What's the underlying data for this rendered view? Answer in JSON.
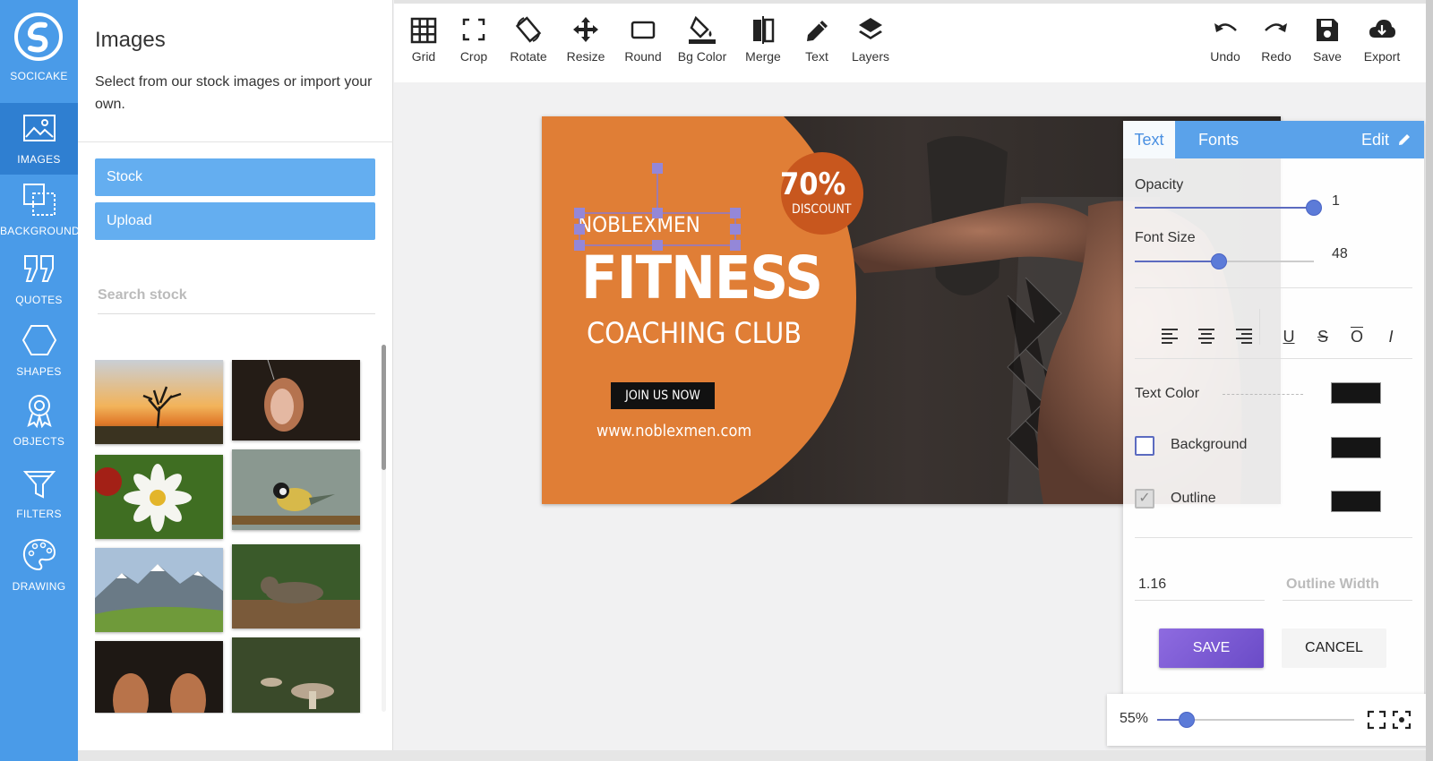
{
  "app": {
    "name": "SOCICAKE"
  },
  "nav": {
    "items": [
      {
        "label": "IMAGES",
        "icon": "image-icon"
      },
      {
        "label": "BACKGROUND",
        "icon": "background-icon"
      },
      {
        "label": "QUOTES",
        "icon": "quote-icon"
      },
      {
        "label": "SHAPES",
        "icon": "hexagon-icon"
      },
      {
        "label": "OBJECTS",
        "icon": "badge-icon"
      },
      {
        "label": "FILTERS",
        "icon": "funnel-icon"
      },
      {
        "label": "DRAWING",
        "icon": "palette-icon"
      }
    ]
  },
  "panel": {
    "title": "Images",
    "description": "Select from our stock images or import your own.",
    "stock_label": "Stock",
    "upload_label": "Upload",
    "search_placeholder": "Search stock"
  },
  "toolbar": {
    "tools": [
      {
        "label": "Grid",
        "icon": "grid-icon"
      },
      {
        "label": "Crop",
        "icon": "crop-icon"
      },
      {
        "label": "Rotate",
        "icon": "rotate-icon"
      },
      {
        "label": "Resize",
        "icon": "move-icon"
      },
      {
        "label": "Round",
        "icon": "rounded-rect-icon"
      },
      {
        "label": "Bg Color",
        "icon": "paint-bucket-icon"
      },
      {
        "label": "Merge",
        "icon": "merge-icon"
      },
      {
        "label": "Text",
        "icon": "pencil-icon"
      },
      {
        "label": "Layers",
        "icon": "layers-icon"
      }
    ],
    "actions": [
      {
        "label": "Undo",
        "icon": "undo-icon"
      },
      {
        "label": "Redo",
        "icon": "redo-icon"
      },
      {
        "label": "Save",
        "icon": "floppy-icon"
      },
      {
        "label": "Export",
        "icon": "cloud-download-icon"
      }
    ]
  },
  "design": {
    "brand": "NOBLEXMEN",
    "headline": "FITNESS",
    "subheadline": "COACHING CLUB",
    "badge_percent": "70%",
    "badge_text": "DISCOUNT",
    "cta": "JOIN US NOW",
    "url": "www.noblexmen.com",
    "colors": {
      "orange": "#e07e36",
      "badge": "#c8571e",
      "dark": "#262322"
    }
  },
  "props": {
    "tabs": {
      "text": "Text",
      "fonts": "Fonts",
      "edit": "Edit"
    },
    "opacity_label": "Opacity",
    "opacity_value": "1",
    "opacity_level": 1.0,
    "font_size_label": "Font Size",
    "font_size_value": "48",
    "font_size_level": 0.47,
    "text_color_label": "Text Color",
    "background_label": "Background",
    "outline_label": "Outline",
    "line_height_value": "1.16",
    "outline_width_placeholder": "Outline Width",
    "save_label": "SAVE",
    "cancel_label": "CANCEL",
    "swatch_color": "#151515",
    "accent": "#5c6bc0"
  },
  "zoom": {
    "value": "55%",
    "level": 0.15
  }
}
